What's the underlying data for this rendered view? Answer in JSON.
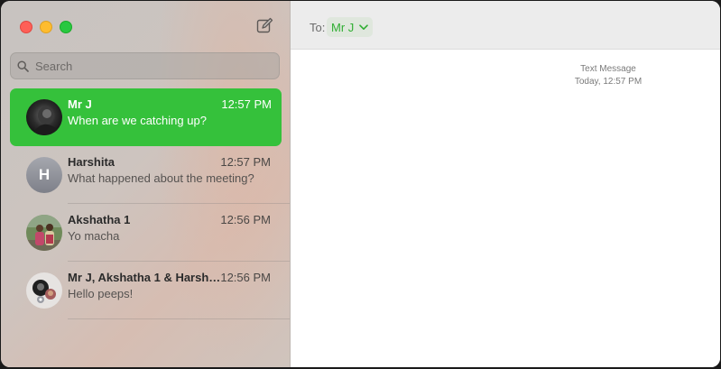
{
  "sidebar": {
    "search": {
      "placeholder": "Search"
    },
    "conversations": [
      {
        "name": "Mr J",
        "time": "12:57 PM",
        "preview": "When are we catching up?",
        "selected": true
      },
      {
        "name": "Harshita",
        "time": "12:57 PM",
        "preview": "What happened about the meeting?",
        "initial": "H"
      },
      {
        "name": "Akshatha 1",
        "time": "12:56 PM",
        "preview": "Yo macha"
      },
      {
        "name": "Mr J, Akshatha 1 & Harsh…",
        "time": "12:56 PM",
        "preview": "Hello peeps!"
      }
    ]
  },
  "header": {
    "to_label": "To:",
    "recipient": "Mr J"
  },
  "thread": {
    "service": "Text Message",
    "timestamp": "Today, 12:57 PM"
  },
  "colors": {
    "accent": "#35c13b",
    "recipient_text": "#2fae32"
  },
  "icons": {
    "compose": "compose-icon",
    "search": "search-icon",
    "chevron": "chevron-down-icon"
  }
}
